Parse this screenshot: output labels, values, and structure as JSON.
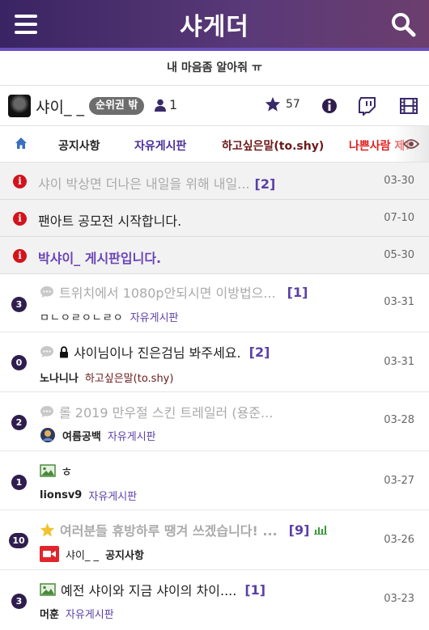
{
  "header": {
    "brand": "샤게더",
    "subtitle": "내 마음좀 알아줘 ㅠ"
  },
  "user": {
    "name": "샤이_ _",
    "rank": "순위권 밖",
    "members": "1",
    "stars": "57"
  },
  "tabs": [
    {
      "label": "공지사항",
      "color": "#222222"
    },
    {
      "label": "자유게시판",
      "color": "#4b2f9a"
    },
    {
      "label": "하고싶은말(to.shy)",
      "color": "#6b1a1a"
    },
    {
      "label": "나쁜사람 제!",
      "color": "#e02020"
    }
  ],
  "notices": [
    {
      "title": "샤이 박상면 더나은 내일을 위해 내일...",
      "count": "[2]",
      "date": "03-30",
      "color": "#aaaaaa"
    },
    {
      "title": "팬아트 공모전 시작합니다.",
      "count": "",
      "date": "07-10",
      "color": "#222222"
    },
    {
      "title": "박샤이_ 게시판입니다.",
      "count": "",
      "date": "05-30",
      "color": "#6a44b8"
    }
  ],
  "posts": [
    {
      "comments": "3",
      "icon": "chat-icon",
      "title": "트위치에서 1080p안되시면 이방법으...",
      "title_color": "#aaaaaa",
      "count": "[1]",
      "author": "ㅁㄴㅇㄹㅇㄴㄹㅇ",
      "board": "자유게시판",
      "date": "03-31"
    },
    {
      "comments": "0",
      "icon": "chat-lock-icon",
      "title": "샤이님이나 진은검님 봐주세요.",
      "title_color": "#222222",
      "count": "[2]",
      "author": "노나니나",
      "board": "하고싶은말(to.shy)",
      "date": "03-31"
    },
    {
      "comments": "2",
      "icon": "chat-icon",
      "title": "롤 2019 만우절 스킨 트레일러 (용준...",
      "title_color": "#aaaaaa",
      "count": "",
      "author": "여름공백",
      "board": "자유게시판",
      "date": "03-28"
    },
    {
      "comments": "1",
      "icon": "image-icon",
      "title": "ㅎ",
      "title_color": "#222222",
      "count": "",
      "author": "lionsv9",
      "board": "자유게시판",
      "date": "03-27"
    },
    {
      "comments": "10",
      "icon": "star-icon",
      "title": "여러분들 휴방하루 땡겨 쓰겠습니다! ...",
      "title_color": "#aaaaaa",
      "count": "[9]",
      "author": "샤이_ _",
      "board": "공지사항",
      "date": "03-26"
    },
    {
      "comments": "3",
      "icon": "image-icon",
      "title": "예전 샤이와 지금 샤이의 차이....",
      "title_color": "#222222",
      "count": "[1]",
      "author": "머훈",
      "board": "자유게시판",
      "date": "03-23"
    }
  ],
  "colors": {
    "accent": "#5a3fa8",
    "header_start": "#3a2463",
    "header_end": "#6b3e6e",
    "notice_icon": "#d3131b",
    "count_badge": "#2f1e4d"
  }
}
